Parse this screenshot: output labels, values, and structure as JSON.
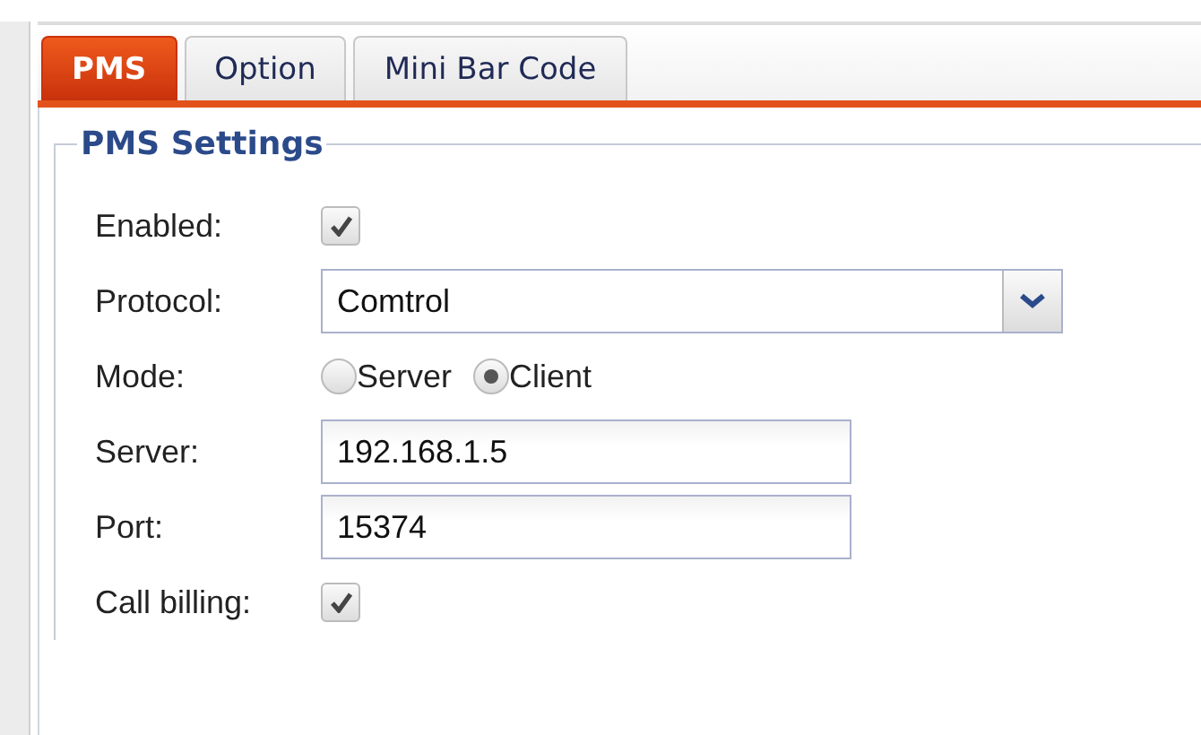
{
  "tabs": [
    {
      "label": "PMS",
      "selected": true
    },
    {
      "label": "Option",
      "selected": false
    },
    {
      "label": "Mini Bar Code",
      "selected": false
    }
  ],
  "settings": {
    "legend": "PMS Settings",
    "fields": [
      {
        "kind": "checkbox",
        "label": "Enabled:",
        "checked": true
      },
      {
        "kind": "select",
        "label": "Protocol:",
        "value": "Comtrol"
      },
      {
        "kind": "radio",
        "label": "Mode:",
        "options": [
          {
            "label": "Server",
            "selected": false
          },
          {
            "label": "Client",
            "selected": true
          }
        ]
      },
      {
        "kind": "text",
        "label": "Server:",
        "value": "192.168.1.5"
      },
      {
        "kind": "text",
        "label": "Port:",
        "value": "15374"
      },
      {
        "kind": "checkbox",
        "label": "Call billing:",
        "checked": true
      }
    ]
  }
}
